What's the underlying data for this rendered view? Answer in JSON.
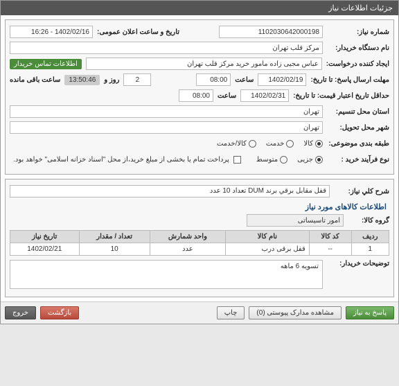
{
  "titlebar": "جزئیات اطلاعات نیاز",
  "top": {
    "need_no_label": "شماره نیاز:",
    "need_no": "1102030642000198",
    "public_date_label": "تاریخ و ساعت اعلان عمومی:",
    "public_date": "1402/02/16 - 16:26",
    "buyer_org_label": "نام دستگاه خریدار:",
    "buyer_org": "مرکز قلب تهران",
    "requester_label": "ایجاد کننده درخواست:",
    "requester": "عباس  مجیی زاده مامور خرید مرکز قلب تهران",
    "contact_badge": "اطلاعات تماس خریدار",
    "deadline_label": "مهلت ارسال پاسخ: تا تاریخ:",
    "deadline_date": "1402/02/19",
    "time_label": "ساعت",
    "deadline_time": "08:00",
    "day_label": "روز و",
    "days_left": "2",
    "remain_label": "ساعت باقی مانده",
    "remain_time": "13:50:46",
    "min_valid_label": "حداقل تاریخ اعتبار قیمت: تا تاریخ:",
    "min_valid_date": "1402/02/31",
    "min_valid_time": "08:00",
    "province_label": "استان محل تنسیم:",
    "province": "تهران",
    "city_label": "شهر محل تحویل:",
    "city": "تهران",
    "category_label": "طبقه بندی موضوعی:",
    "cat_goods": "کالا",
    "cat_service": "خدمت",
    "cat_goods_service": "کالا/خدمت",
    "process_label": "نوع فرآیند خرید :",
    "proc_small": "جزیی",
    "proc_medium": "متوسط",
    "pay_note": "پرداخت تمام یا بخشی از مبلغ خرید،از محل \"اسناد خزانه اسلامی\" خواهد بود."
  },
  "detail": {
    "desc_label": "شرح کلي نياز:",
    "desc": "قفل مقابل برقي برند DUM تعداد 10 عدد",
    "items_header": "اطلاعات کالاهای مورد نیاز",
    "group_label": "گروه کالا:",
    "group": "امور تاسیساتی",
    "buyer_notes_label": "توضیحات خریدار:",
    "buyer_notes": "تسویه 6 ماهه"
  },
  "table": {
    "headers": {
      "row": "ردیف",
      "code": "کد کالا",
      "name": "نام کالا",
      "unit": "واحد شمارش",
      "qty": "تعداد / مقدار",
      "date": "تاریخ نیاز"
    },
    "rows": [
      {
        "row": "1",
        "code": "--",
        "name": "قفل برقی درب",
        "unit": "عدد",
        "qty": "10",
        "date": "1402/02/21"
      }
    ]
  },
  "footer": {
    "respond": "پاسخ به نیاز",
    "attachments": "مشاهده مدارک پیوستی (0)",
    "print": "چاپ",
    "back": "بازگشت",
    "exit": "خروج"
  }
}
